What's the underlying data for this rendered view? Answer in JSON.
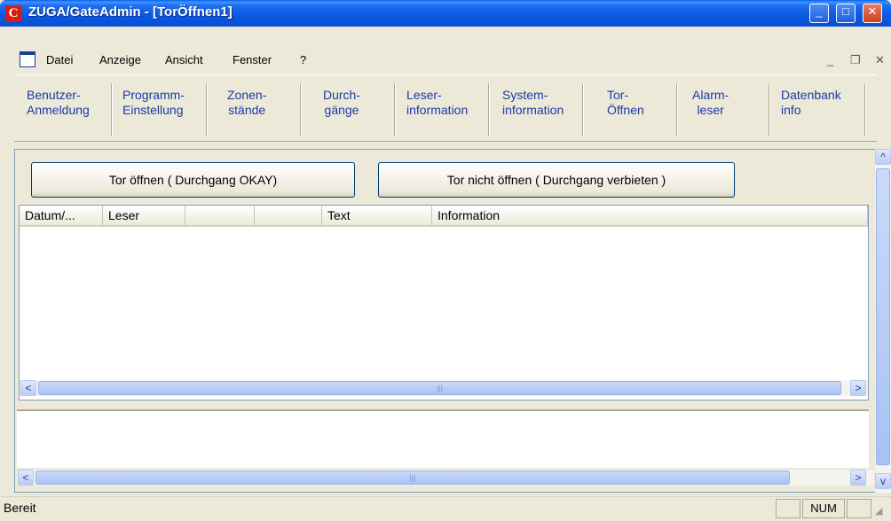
{
  "window": {
    "title": "ZUGA/GateAdmin - [TorÖffnen1]",
    "app_icon_glyph": "C",
    "title_color": "#0a5ce8",
    "controls": {
      "minimize": "_",
      "maximize": "□",
      "close": "✕"
    }
  },
  "menu": {
    "items": [
      "Datei",
      "Anzeige",
      "Ansicht",
      "Fenster",
      "?"
    ],
    "mdi_controls": {
      "minimize": "_",
      "restore": "❐",
      "close": "✕"
    }
  },
  "toolbar": {
    "buttons": [
      {
        "line1": "Benutzer-",
        "line2": "Anmeldung"
      },
      {
        "line1": "Programm-",
        "line2": "Einstellung"
      },
      {
        "line1": "Zonen-",
        "line2": "stände"
      },
      {
        "line1": "Durch-",
        "line2": "gänge"
      },
      {
        "line1": "Leser-",
        "line2": "information"
      },
      {
        "line1": "System-",
        "line2": "information"
      },
      {
        "line1": "Tor-",
        "line2": "Öffnen"
      },
      {
        "line1": "Alarm-",
        "line2": "leser"
      },
      {
        "line1": "Datenbank",
        "line2": "info"
      }
    ]
  },
  "actions": {
    "open_gate": "Tor öffnen ( Durchgang OKAY)",
    "deny_gate": "Tor nicht öffnen ( Durchgang verbieten )"
  },
  "list": {
    "columns": [
      "Datum/...",
      "Leser",
      "",
      "",
      "Text",
      "Information"
    ]
  },
  "scroll": {
    "left_arrow": "<",
    "right_arrow": ">",
    "up_arrow": "^",
    "down_arrow": "v",
    "grip": "|||"
  },
  "status": {
    "text": "Bereit",
    "num": "NUM"
  }
}
